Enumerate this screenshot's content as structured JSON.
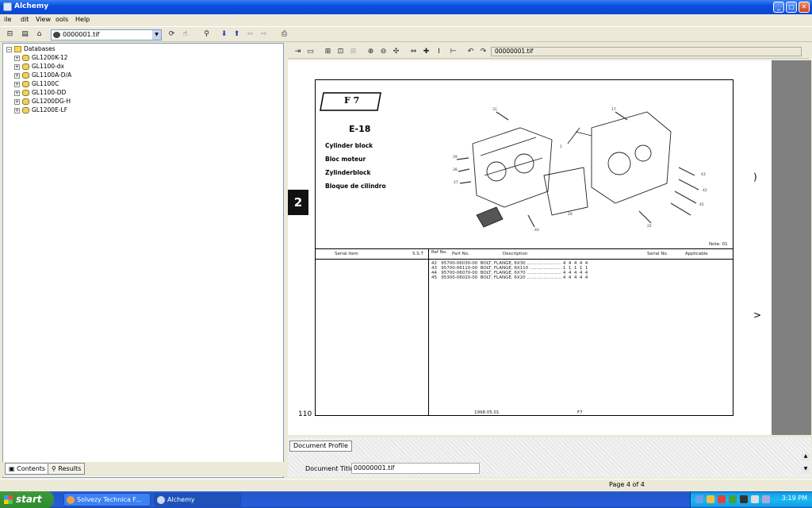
{
  "window": {
    "title": "Alchemy"
  },
  "menu": [
    "ile",
    "dit",
    "View",
    "ools",
    "Help"
  ],
  "toolbar": {
    "database_combo": "0000001.tif"
  },
  "tree": {
    "root": "Databases",
    "items": [
      "GL1200K-12",
      "GL1100-dx",
      "GL1100A-D/A",
      "GL1100C",
      "GL1100-DD",
      "GL1200DG-H",
      "GL1200E-LF"
    ]
  },
  "left_tabs": {
    "contents": "Contents",
    "results": "Results"
  },
  "viewer_toolbar": {
    "path": "00000001.tif"
  },
  "document": {
    "fig_label": "F 7",
    "code": "E-18",
    "names": [
      "Cylinder block",
      "Bloc moteur",
      "Zylinderblock",
      "Bloque de cilindro"
    ],
    "section_badge": "2",
    "page_number": "110",
    "table_headers": [
      "Ref No.",
      "Part No.",
      "Description",
      "Serial No.",
      "Applicable"
    ],
    "left_headers": [
      "Serial item",
      "S.S.T"
    ],
    "rows": [
      {
        "ref": "42",
        "part": "95700-06030-00",
        "desc": "BOLT, FLANGE, 6X30"
      },
      {
        "ref": "43",
        "part": "95700-06110-00",
        "desc": "BOLT, FLANGE, 6X110"
      },
      {
        "ref": "44",
        "part": "95700-06070-00",
        "desc": "BOLT, FLANGE, 6X70"
      },
      {
        "ref": "45",
        "part": "95300-06020-00",
        "desc": "BOLT, FLANGE, 6X20"
      }
    ],
    "footer_left": "1998.05.01",
    "footer_right": "F7"
  },
  "doc_profile": {
    "tab": "Document Profile",
    "title_label": "Document Title:",
    "title_value": "00000001.tif"
  },
  "status": {
    "page": "Page 4 of 4"
  },
  "taskbar": {
    "start": "start",
    "tasks": [
      "Solvezy Technica F...",
      "Alchemy"
    ],
    "clock": "3:19 PM"
  }
}
